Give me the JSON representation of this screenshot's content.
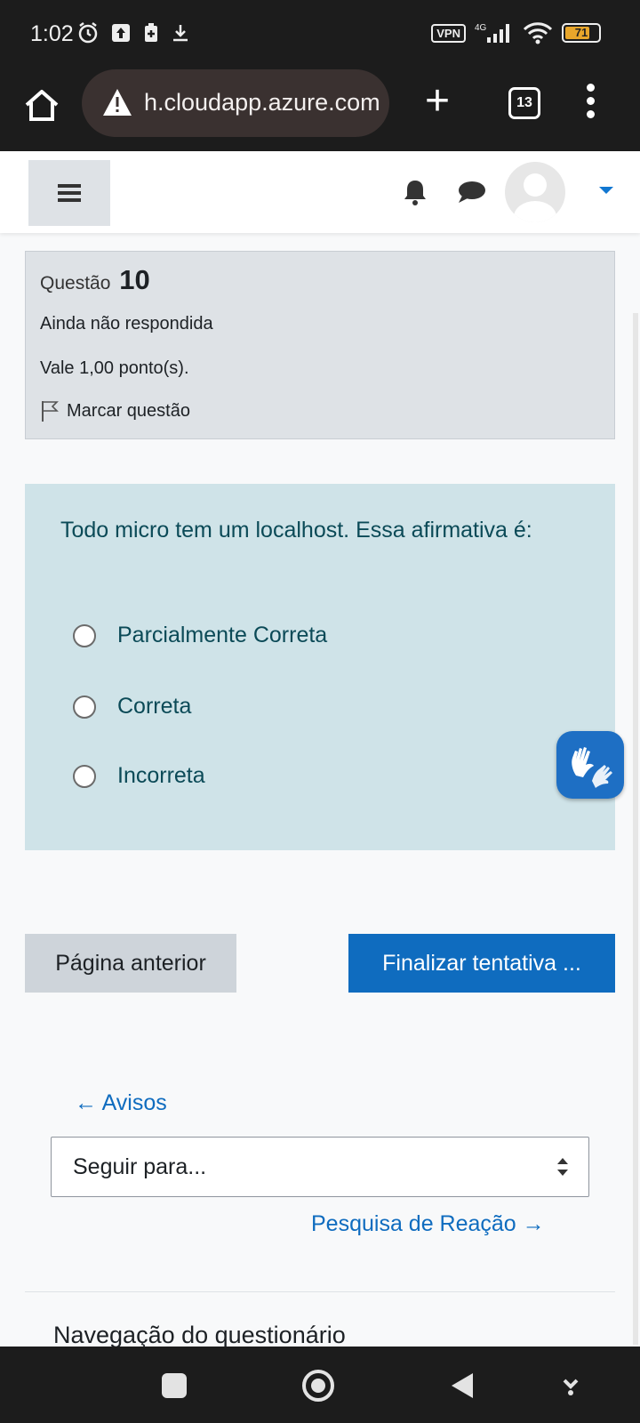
{
  "status_bar": {
    "time": "1:02",
    "vpn": "VPN",
    "network": "4G",
    "battery": "71"
  },
  "browser": {
    "url": "h.cloudapp.azure.com",
    "tab_count": "13"
  },
  "question_info": {
    "label": "Questão",
    "number": "10",
    "state": "Ainda não respondida",
    "grade": "Vale 1,00 ponto(s).",
    "flag_label": "Marcar questão"
  },
  "question": {
    "prompt": "Todo micro tem um localhost. Essa afirmativa é:",
    "answers": [
      "Parcialmente Correta",
      "Correta",
      "Incorreta"
    ]
  },
  "buttons": {
    "previous": "Página anterior",
    "finish": "Finalizar tentativa ..."
  },
  "activity_nav": {
    "prev_link": "← Avisos",
    "jump_placeholder": "Seguir para...",
    "next_link": "Pesquisa de Reação →"
  },
  "section": {
    "quiz_navigation": "Navegação do questionário"
  },
  "colors": {
    "link": "#0f6cbf",
    "question_bg": "#cfe3e8",
    "info_bg": "#dee2e6"
  }
}
